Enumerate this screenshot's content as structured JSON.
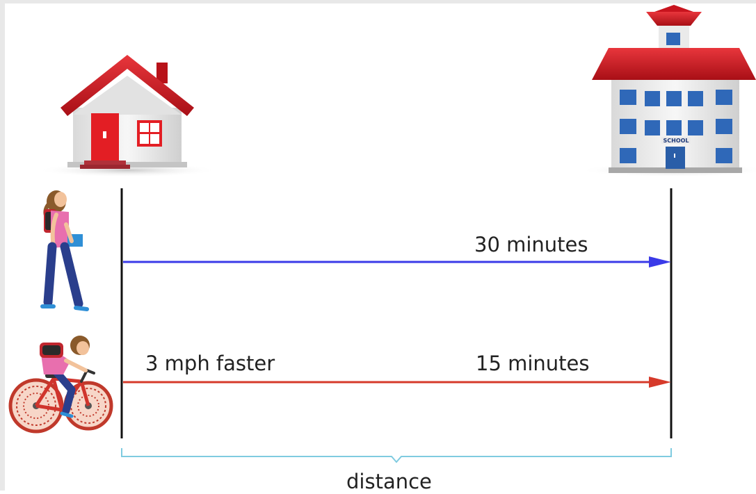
{
  "walk": {
    "time_label": "30 minutes",
    "arrow_color": "#3a3ae8"
  },
  "bike": {
    "speed_label": "3 mph faster",
    "time_label": "15 minutes",
    "arrow_color": "#d63a2a"
  },
  "distance": {
    "label": "distance",
    "brace_color": "#7fcbe0"
  },
  "school_sign": "SCHOOL",
  "colors": {
    "roof_red": "#c8141e",
    "wall": "#ececec",
    "window_blue": "#2f68b8",
    "door_red": "#e31e24",
    "line_black": "#111111"
  },
  "icons": [
    "house-icon",
    "school-icon",
    "walking-girl-icon",
    "cyclist-icon"
  ]
}
